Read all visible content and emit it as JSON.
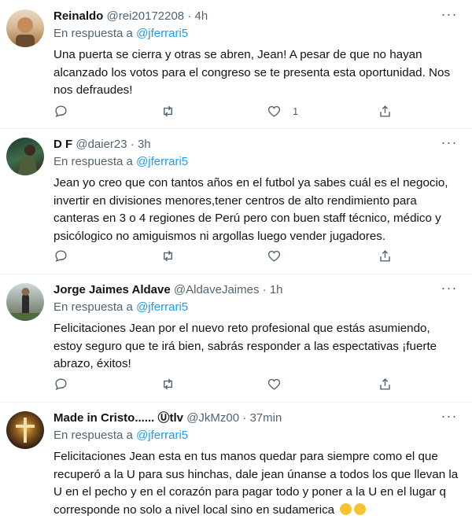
{
  "colors": {
    "accent": "#1d9bf0",
    "secondary": "#536471",
    "text": "#0f1419",
    "divider": "#eff3f4"
  },
  "tweets": [
    {
      "name": "Reinaldo",
      "handle": "@rei20172208",
      "dot": "·",
      "time": "4h",
      "reply_prefix": "En respuesta a",
      "reply_to": "@jferrari5",
      "text": "Una puerta se cierra y otras se abren, Jean! A pesar de que no hayan alcanzado los votos para el congreso se te presenta esta oportunidad. Nos nos defraudes!",
      "like_count": "1"
    },
    {
      "name": "D F",
      "handle": "@daier23",
      "dot": "·",
      "time": "3h",
      "reply_prefix": "En respuesta a",
      "reply_to": "@jferrari5",
      "text": "Jean yo creo que con tantos años en el futbol ya sabes cuál es el negocio, invertir en divisiones menores,tener centros de alto rendimiento para canteras en 3 o 4 regiones de Perú pero con buen staff técnico, médico y psicólogico no amiguismos ni argollas luego vender jugadores."
    },
    {
      "name": "Jorge Jaimes Aldave",
      "handle": "@AldaveJaimes",
      "dot": "·",
      "time": "1h",
      "reply_prefix": "En respuesta a",
      "reply_to": "@jferrari5",
      "text": "Felicitaciones Jean por el nuevo reto profesional que estás asumiendo, estoy seguro que te irá bien, sabrás responder a las espectativas ¡fuerte abrazo, éxitos!"
    },
    {
      "name": "Made in Cristo...... Ⓤtlv",
      "handle": "@JkMz00",
      "dot": "·",
      "time": "37min",
      "reply_prefix": "En respuesta a",
      "reply_to": "@jferrari5",
      "text": "Felicitaciones Jean esta en tus manos quedar para siempre como el que recuperó a la U para sus hinchas, dale jean únanse a todos los que llevan la U en el pecho y en el corazón para pagar todo y poner a la U en el lugar q corresponde no solo a nivel local sino en sudamerica",
      "emoji": [
        "flexed-biceps-emoji",
        "flexed-biceps-emoji"
      ]
    }
  ],
  "icons": [
    "more-icon",
    "reply-icon",
    "retweet-icon",
    "like-icon",
    "share-icon"
  ]
}
